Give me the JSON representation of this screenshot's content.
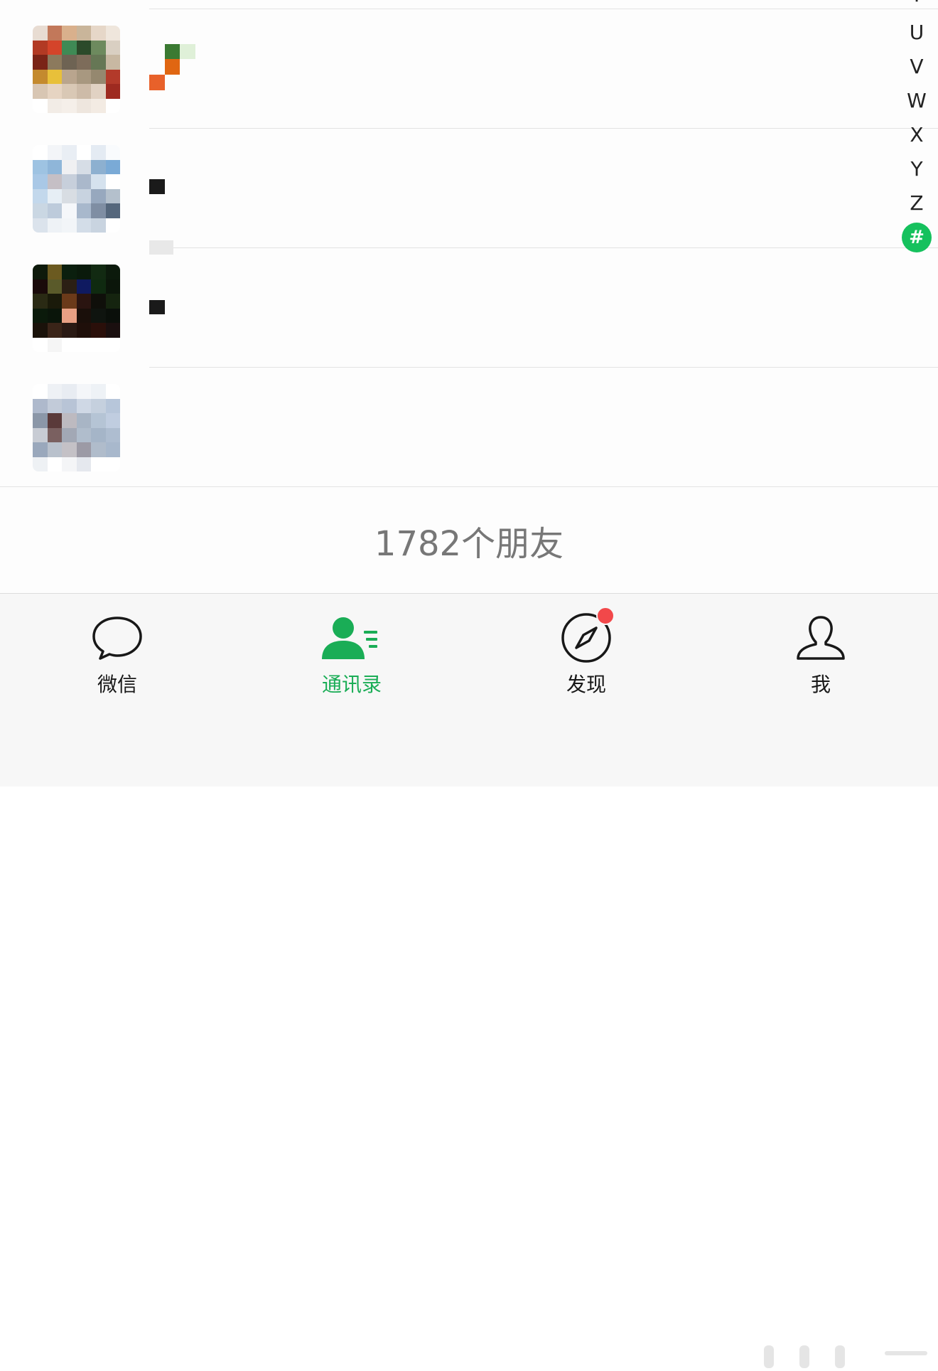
{
  "contacts": [
    {
      "avatar_colors": [
        "#e8dcd2",
        "#c2785a",
        "#d9b08c",
        "#c9b59a",
        "#e6d7c8",
        "#efe6dc",
        "#b23a24",
        "#d4442a",
        "#3f8a55",
        "#2b4a2a",
        "#6d8a5e",
        "#d9cfc2",
        "#7a2417",
        "#8c7a5d",
        "#6e6353",
        "#7d6c5a",
        "#667755",
        "#c8b8a2",
        "#c48a2e",
        "#e8c03a",
        "#b9a58e",
        "#a89880",
        "#95886f",
        "#b33a2a",
        "#d8c6b3",
        "#e6d4c2",
        "#d9c8b5",
        "#cdbba8",
        "#e1d2c3",
        "#9e2a20",
        "#ffffff",
        "#f2ece6",
        "#f5efe9",
        "#eee6de",
        "#f3ebe3",
        "#ffffff"
      ]
    },
    {
      "avatar_colors": [
        "#ffffff",
        "#f3f5f8",
        "#e9eef4",
        "#ffffff",
        "#e4ebf3",
        "#f9fbfd",
        "#9ec3e2",
        "#8fb6d9",
        "#f0f0f2",
        "#d6dde6",
        "#8db0d0",
        "#7aaad6",
        "#a9c8e6",
        "#c5bfc5",
        "#c7cfdb",
        "#aab8cb",
        "#d5e2ee",
        "#ffffff",
        "#c3d8ec",
        "#e6eef5",
        "#d8dde3",
        "#c8d3e0",
        "#97a8be",
        "#b4c0cc",
        "#cad7e3",
        "#bdcbdb",
        "#f5f7fa",
        "#a8b8cc",
        "#7f8ea3",
        "#55677c",
        "#dbe3ec",
        "#eef2f6",
        "#f2f5f8",
        "#d3dde8",
        "#c9d4e0",
        "#ffffff"
      ]
    },
    {
      "avatar_colors": [
        "#0e1a0b",
        "#6b5a20",
        "#0b1f0e",
        "#0a1a0b",
        "#122a12",
        "#0c1a0c",
        "#1a0a0a",
        "#5a5a2a",
        "#2b1f14",
        "#0f1a60",
        "#0f2a10",
        "#0b160a",
        "#2a2a14",
        "#1a1a0a",
        "#6b3a1a",
        "#2a1410",
        "#0f0f0a",
        "#15240f",
        "#0b1a0b",
        "#0a150a",
        "#e8a084",
        "#1a0f0a",
        "#0f140f",
        "#0a0f0a",
        "#1a120a",
        "#3a2418",
        "#2a1a14",
        "#1f0f0a",
        "#2a0f0a",
        "#1a0f0f",
        "#ffffff",
        "#f5f5f5",
        "#ffffff",
        "#ffffff",
        "#ffffff",
        "#ffffff"
      ]
    },
    {
      "avatar_colors": [
        "#ffffff",
        "#eef1f5",
        "#e8ecf2",
        "#f4f6f9",
        "#eef2f6",
        "#ffffff",
        "#aeb9cc",
        "#c2cbd9",
        "#b8c4d6",
        "#cfd8e5",
        "#c5d0de",
        "#b7c6da",
        "#8b97a8",
        "#5a3a3a",
        "#bdbac0",
        "#a8b5c5",
        "#b5c4d5",
        "#c0cde0",
        "#c8ccd4",
        "#7a6060",
        "#a2a8b5",
        "#b0bdcc",
        "#a5b5c8",
        "#aebdd0",
        "#9aa8bc",
        "#b9c1cc",
        "#c4c1c6",
        "#9c9aa5",
        "#b0bccb",
        "#a8b8cc",
        "#eef1f4",
        "#ffffff",
        "#f4f5f7",
        "#e5e8ee",
        "#ffffff",
        "#ffffff"
      ]
    }
  ],
  "index_letters": [
    "T",
    "U",
    "V",
    "W",
    "X",
    "Y",
    "Z"
  ],
  "index_active": "#",
  "friend_count": "1782个朋友",
  "tabs": [
    {
      "label": "微信",
      "icon": "chat-bubble-icon"
    },
    {
      "label": "通讯录",
      "icon": "contacts-icon",
      "active": true
    },
    {
      "label": "发现",
      "icon": "compass-icon",
      "badge": true
    },
    {
      "label": "我",
      "icon": "person-icon"
    }
  ],
  "colors": {
    "accent": "#1aad56",
    "badge": "#f2484a",
    "index_active": "#15c15d"
  }
}
